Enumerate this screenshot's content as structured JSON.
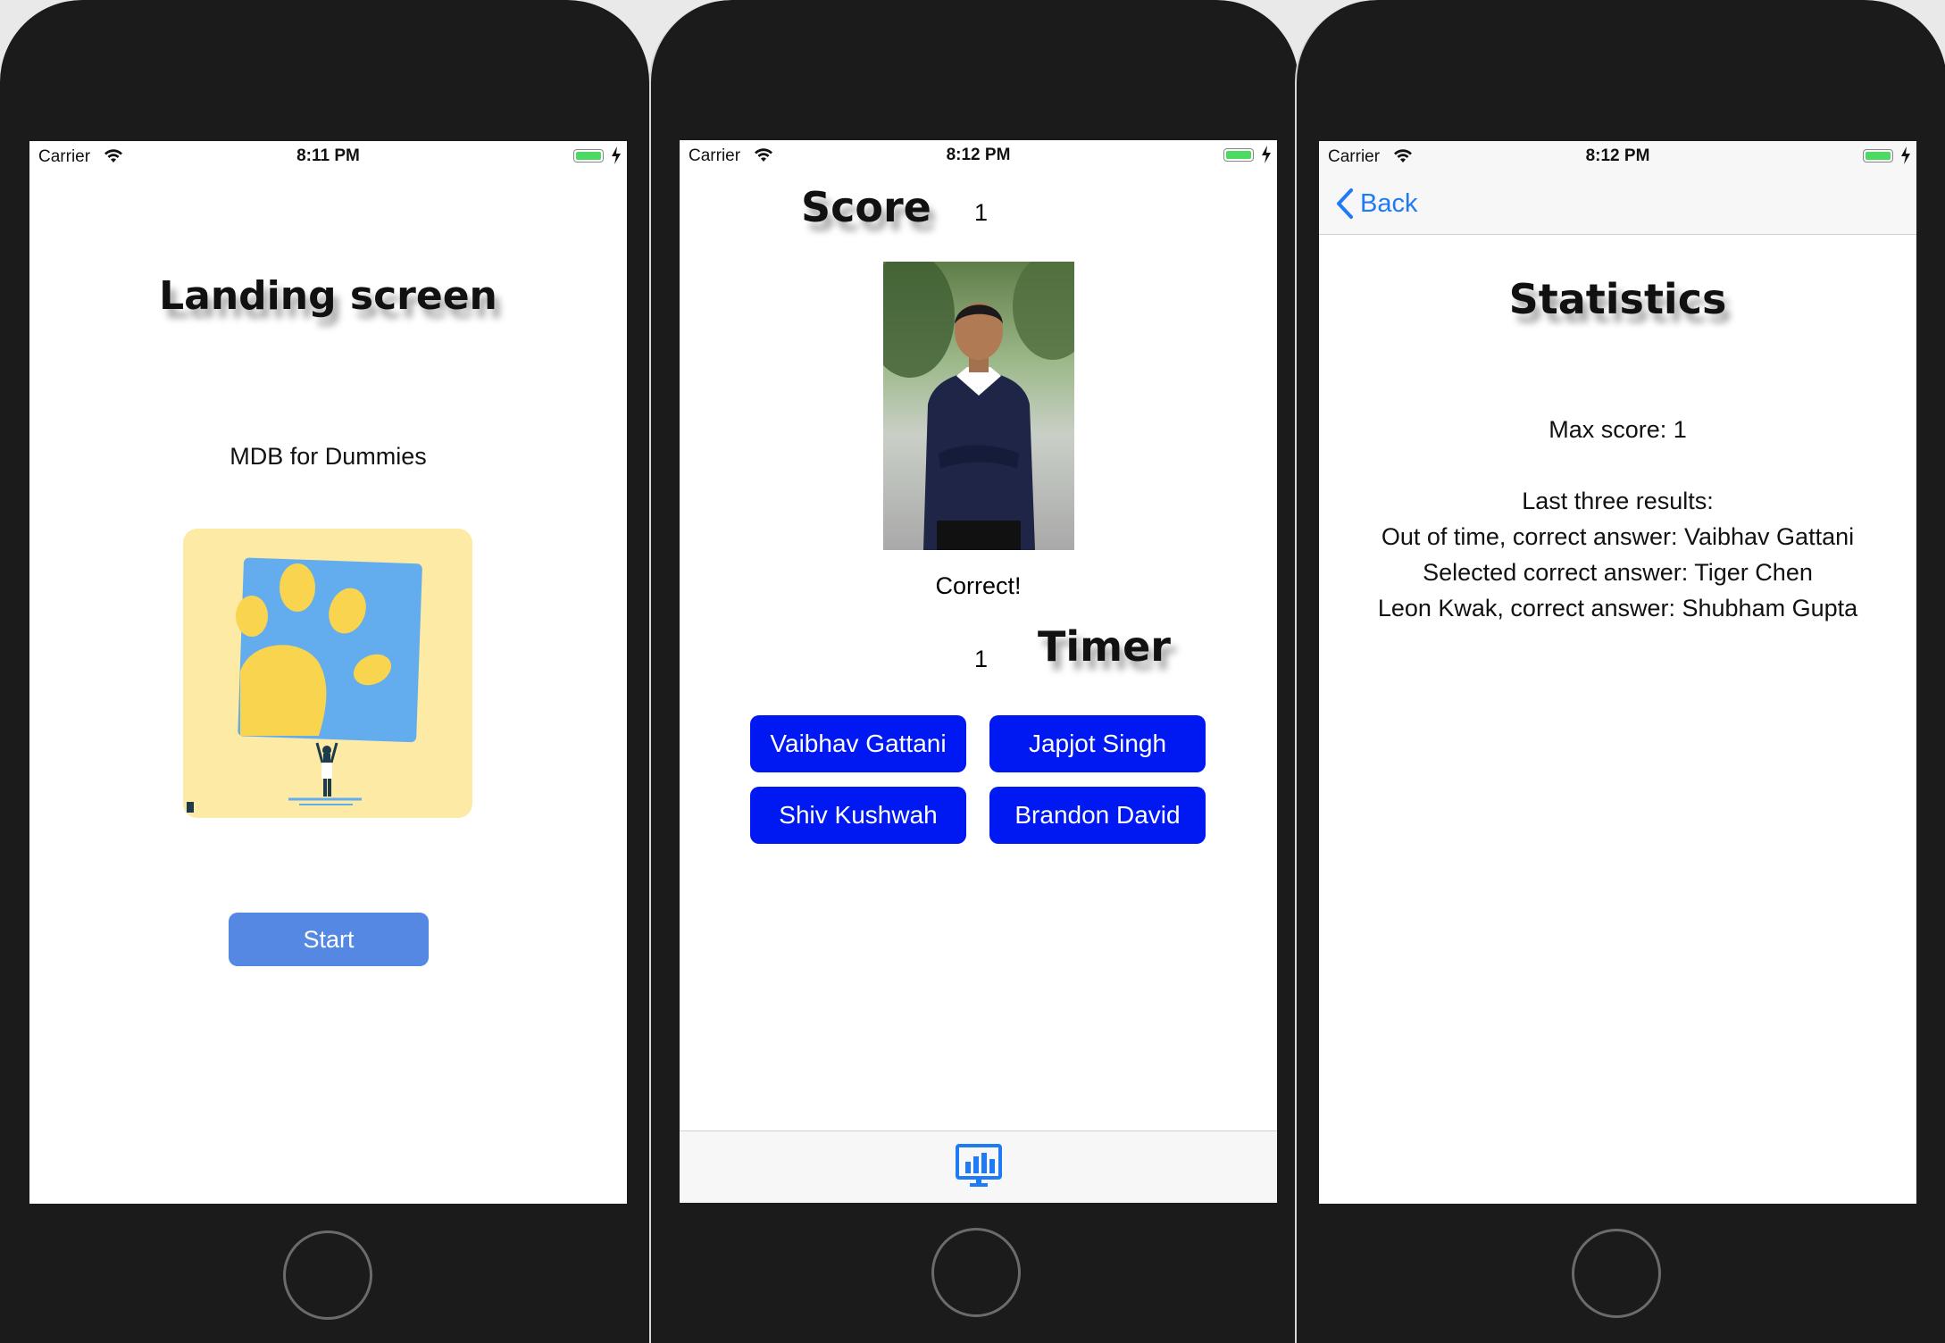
{
  "status": {
    "carrier": "Carrier",
    "time_landing": "8:11 PM",
    "time_game": "8:12 PM",
    "time_stats": "8:12 PM"
  },
  "landing": {
    "title": "Landing screen",
    "subtitle": "MDB for Dummies",
    "start_label": "Start",
    "logo_colors": {
      "background": "#FDEAA5",
      "card": "#63ADEE",
      "paw": "#F9D44F"
    }
  },
  "game": {
    "score_label": "Score",
    "score_value": "1",
    "result_text": "Correct!",
    "timer_label": "Timer",
    "timer_value": "1",
    "answers": [
      {
        "label": "Vaibhav Gattani"
      },
      {
        "label": "Japjot Singh"
      },
      {
        "label": "Shiv Kushwah"
      },
      {
        "label": "Brandon David"
      }
    ],
    "button_color": "#0018F2",
    "tab_icon": "statistics-icon"
  },
  "stats": {
    "back_label": "Back",
    "title": "Statistics",
    "max_score": "Max score: 1",
    "last_header": "Last three results:",
    "results": [
      "Out of time, correct answer: Vaibhav Gattani",
      "Selected correct answer: Tiger Chen",
      "Leon Kwak, correct answer: Shubham Gupta"
    ],
    "accent": "#1F7AF5"
  }
}
